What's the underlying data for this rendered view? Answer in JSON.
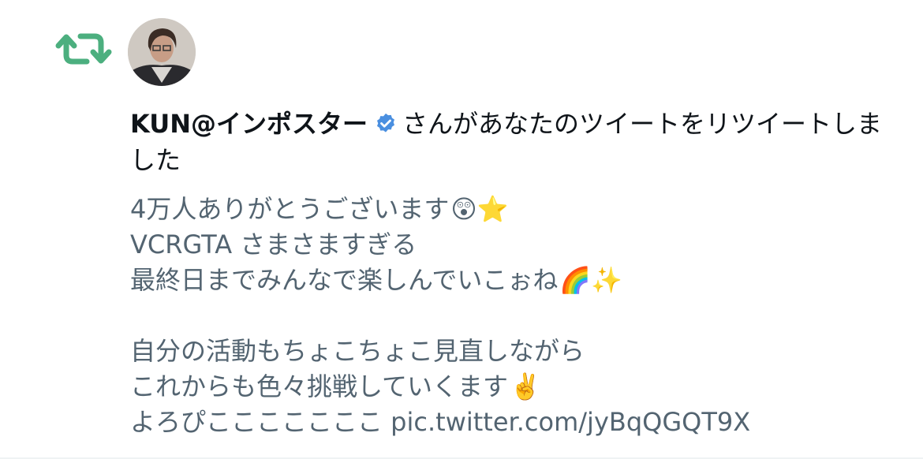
{
  "notification": {
    "username": "KUN@インポスター",
    "action_text": "さんがあなたのツイートをリツイートしました"
  },
  "tweet": {
    "lines": [
      {
        "text": "4万人ありがとうございます",
        "emoji": "😲⭐"
      },
      {
        "text": "VCRGTA さまさますぎる",
        "emoji": ""
      },
      {
        "text": "最終日までみんなで楽しんでいこぉね",
        "emoji": "🌈✨"
      },
      {
        "text": "",
        "emoji": ""
      },
      {
        "text": "自分の活動もちょこちょこ見直しながら",
        "emoji": ""
      },
      {
        "text": "これからも色々挑戦していくます",
        "emoji": "✌️"
      },
      {
        "text": "よろぴこここここここ pic.twitter.com/jyBqQGQT9X",
        "emoji": ""
      }
    ]
  },
  "icons": {
    "retweet": "retweet-icon",
    "verified": "verified-badge-icon",
    "avatar": "user-avatar"
  },
  "colors": {
    "retweet_green": "#4caf7f",
    "verified_blue": "#4a8fe0",
    "primary_text": "#0f1419",
    "secondary_text": "#536471"
  }
}
